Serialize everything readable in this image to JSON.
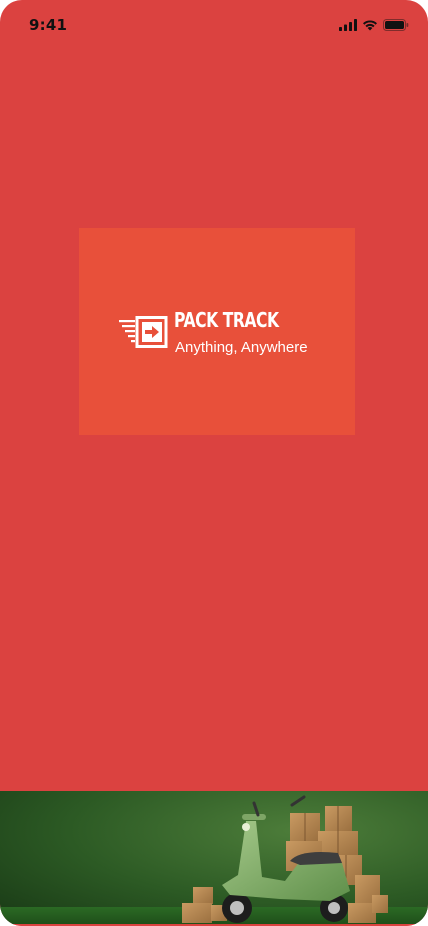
{
  "status_bar": {
    "time": "9:41",
    "icons": [
      "cellular-signal-icon",
      "wifi-icon",
      "battery-icon"
    ]
  },
  "logo": {
    "title": "PACK TRACK",
    "tagline": "Anything, Anywhere",
    "icon": "fast-forward-box-icon"
  },
  "hero_image": {
    "description_icon": "green-scooter-with-parcels-image"
  },
  "colors": {
    "background": "#db4240",
    "logo_card": "#e8503a",
    "text_light": "#ffffff",
    "status_text": "#111111",
    "scene_green": "#2f6b2a"
  }
}
